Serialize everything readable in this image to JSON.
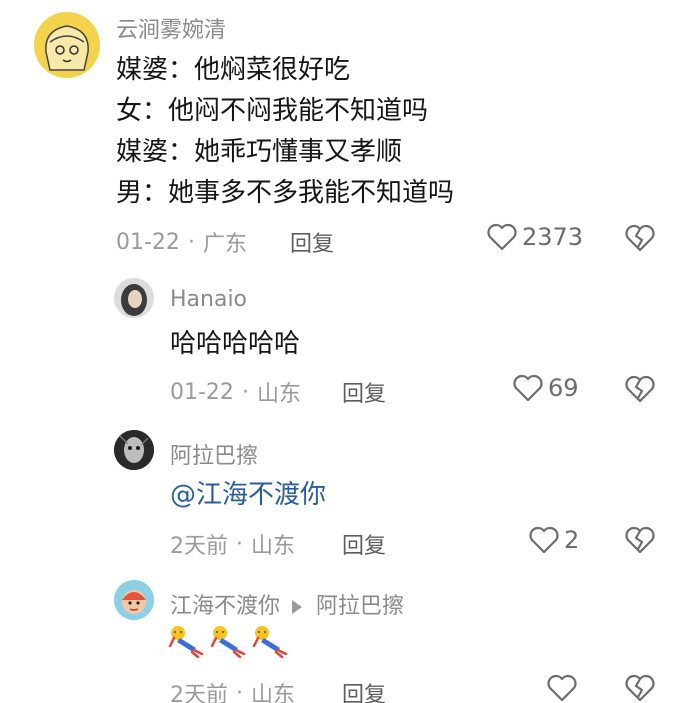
{
  "comments": [
    {
      "username": "云涧雾婉清",
      "lines": [
        "媒婆：他焖菜很好吃",
        "女：他闷不闷我能不知道吗",
        "媒婆：她乖巧懂事又孝顺",
        "男：她事多不多我能不知道吗"
      ],
      "date": "01-22",
      "location": "广东",
      "reply_label": "回复",
      "likes": "2373"
    },
    {
      "username": "Hanaio",
      "text": "哈哈哈哈哈",
      "date": "01-22",
      "location": "山东",
      "reply_label": "回复",
      "likes": "69"
    },
    {
      "username": "阿拉巴擦",
      "text": "@江海不渡你",
      "date": "2天前",
      "location": "山东",
      "reply_label": "回复",
      "likes": "2"
    },
    {
      "username": "江海不渡你",
      "reply_to": "阿拉巴擦",
      "emoji_count": 3,
      "date": "2天前",
      "location": "山东",
      "reply_label": "回复",
      "likes": ""
    }
  ],
  "separator_dot": "·",
  "icons": {
    "like": "heart-outline-icon",
    "dislike": "broken-heart-icon",
    "reply_arrow": "triangle-right-icon"
  }
}
